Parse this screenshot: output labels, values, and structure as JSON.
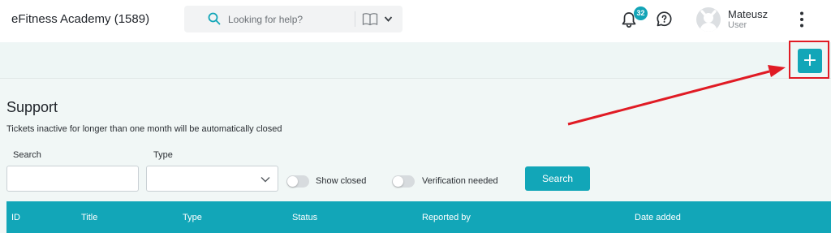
{
  "header": {
    "app_title": "eFitness Academy (1589)",
    "search": {
      "placeholder": "Looking for help?"
    },
    "notifications": {
      "count": "32"
    },
    "user": {
      "name": "Mateusz",
      "role": "User"
    }
  },
  "toolbar": {
    "add_label": "+"
  },
  "page": {
    "title": "Support",
    "notice": "Tickets inactive for longer than one month will be automatically closed"
  },
  "filters": {
    "search_label": "Search",
    "search_value": "",
    "type_label": "Type",
    "type_value": "",
    "show_closed_label": "Show closed",
    "show_closed_on": false,
    "verification_label": "Verification needed",
    "verification_on": false,
    "search_button": "Search"
  },
  "table": {
    "columns": [
      "ID",
      "Title",
      "Type",
      "Status",
      "Reported by",
      "Date added"
    ]
  },
  "colors": {
    "accent": "#12a6b8",
    "annotation": "#e01b24"
  }
}
